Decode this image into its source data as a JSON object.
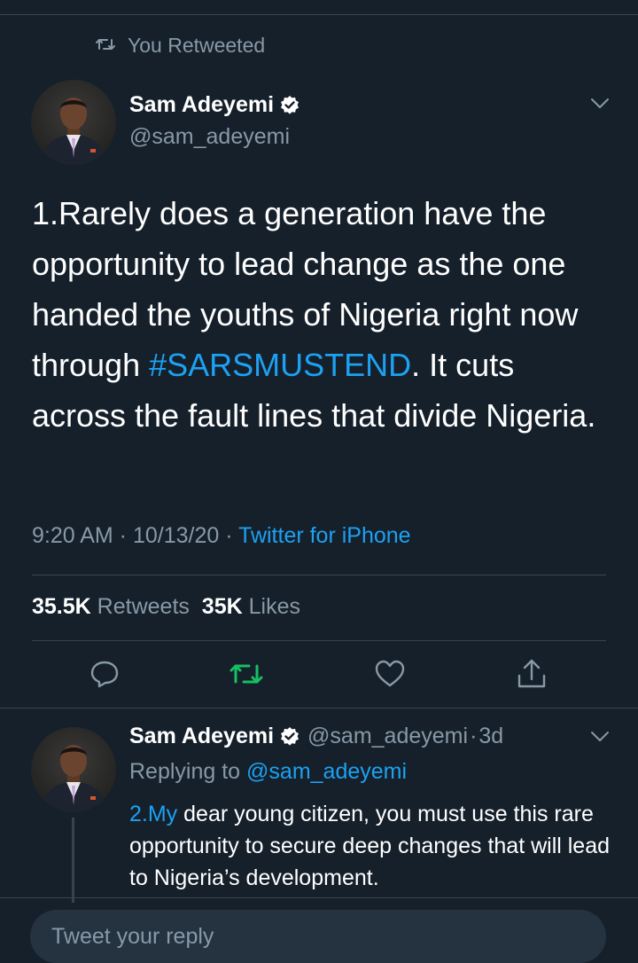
{
  "retweet_banner": {
    "label": "You Retweeted"
  },
  "tweet": {
    "author_name": "Sam Adeyemi",
    "author_handle": "@sam_adeyemi",
    "text_before": "1.Rarely does a generation have the opportunity to lead change as the one handed the youths of Nigeria right now through ",
    "hashtag": "#SARSMUSTEND",
    "text_after": ". It cuts across the fault lines that divide Nigeria.",
    "time": "9:20 AM",
    "date": "10/13/20",
    "source": "Twitter for iPhone",
    "separator": " · ",
    "retweets_count": "35.5K",
    "retweets_label": "Retweets",
    "likes_count": "35K",
    "likes_label": "Likes"
  },
  "actions": [
    {
      "icon": "reply-icon"
    },
    {
      "icon": "retweet-icon",
      "color": "#17bf63"
    },
    {
      "icon": "like-icon"
    },
    {
      "icon": "share-icon"
    }
  ],
  "reply": {
    "author_name": "Sam Adeyemi",
    "author_handle": "@sam_adeyemi",
    "age": "3d",
    "separator": "·",
    "replying_to_label": "Replying to",
    "replying_to_handle": "@sam_adeyemi",
    "text_link": "2.My",
    "text_rest": " dear young citizen, you must use this rare opportunity to secure deep changes that will lead to Nigeria’s development."
  },
  "compose": {
    "placeholder": "Tweet your reply"
  },
  "colors": {
    "background": "#15202b",
    "secondary_text": "#8899a6",
    "link": "#1da1f2",
    "retweet_green": "#17bf63",
    "divider": "#38444d",
    "verified_badge": "#ffffff"
  }
}
